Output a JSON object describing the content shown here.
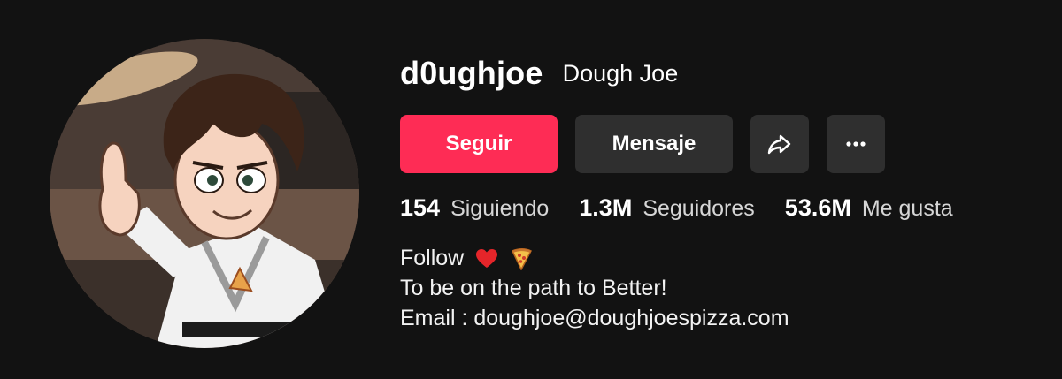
{
  "profile": {
    "username": "d0ughjoe",
    "nickname": "Dough Joe",
    "avatar_alt": "cartoon chef avatar"
  },
  "actions": {
    "follow_label": "Seguir",
    "message_label": "Mensaje",
    "share_icon": "share-arrow-icon",
    "more_icon": "more-dots-icon"
  },
  "stats": [
    {
      "value": "154",
      "label": "Siguiendo"
    },
    {
      "value": "1.3M",
      "label": "Seguidores"
    },
    {
      "value": "53.6M",
      "label": "Me gusta"
    }
  ],
  "bio": {
    "line1": "Follow",
    "line1_emojis": [
      "red-heart-icon",
      "pizza-icon"
    ],
    "line2": "To be on the path to Better!",
    "line3": "Email : doughjoe@doughjoespizza.com"
  },
  "colors": {
    "background": "#121212",
    "follow_button": "#fe2c55",
    "secondary_button": "#2f2f2f"
  }
}
